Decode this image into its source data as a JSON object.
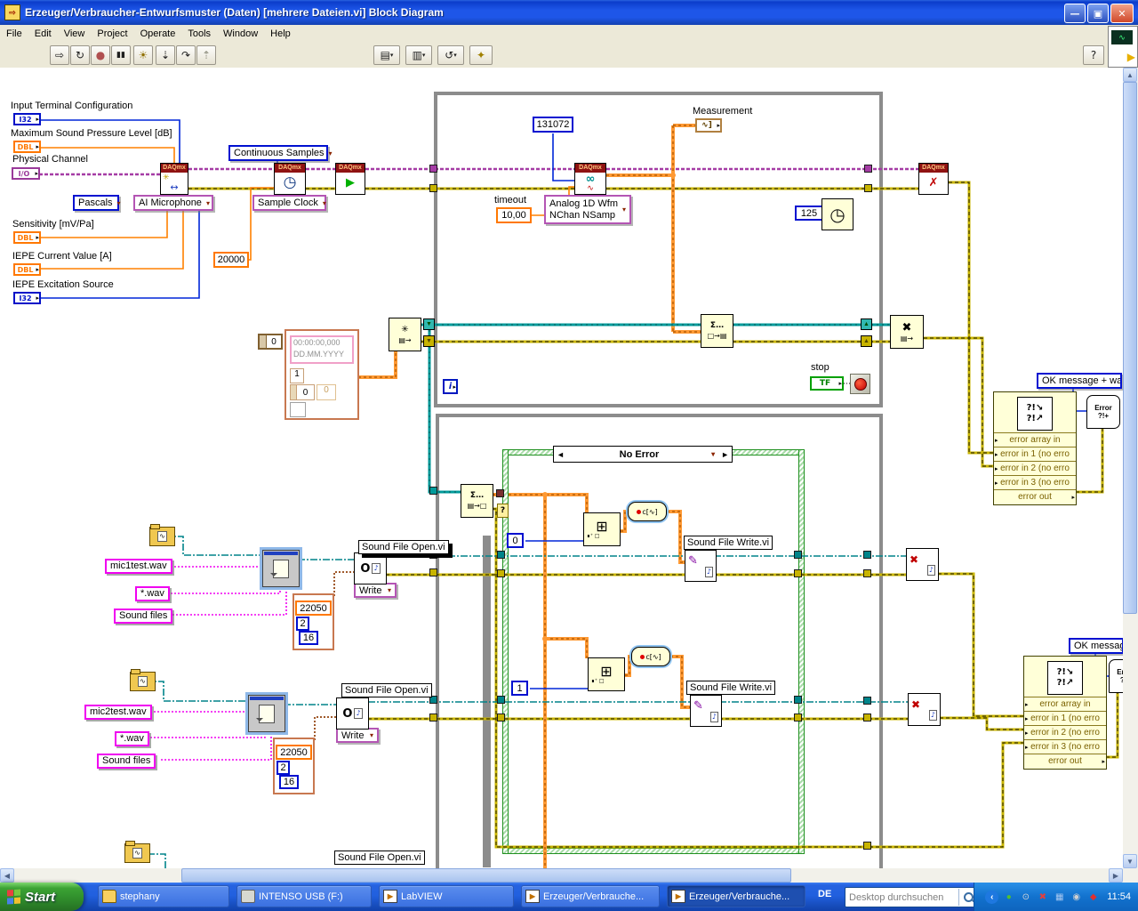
{
  "window": {
    "title": "Erzeuger/Verbraucher-Entwurfsmuster (Daten) [mehrere Dateien.vi] Block Diagram"
  },
  "menu": {
    "items": [
      "File",
      "Edit",
      "View",
      "Project",
      "Operate",
      "Tools",
      "Window",
      "Help"
    ]
  },
  "toolbar": {
    "font": "13pt Application Font",
    "help": "?"
  },
  "controls": {
    "input_terminal": "Input Terminal Configuration",
    "max_pressure": "Maximum Sound Pressure Level  [dB]",
    "physical_channel": "Physical Channel",
    "sensitivity": "Sensitivity [mV/Pa]",
    "iepe_current": "IEPE Current Value [A]",
    "iepe_excitation": "IEPE Excitation Source",
    "t_i32": "I32",
    "t_dbl": "DBL",
    "t_io": "I/O"
  },
  "rings": {
    "pascals": "Pascals",
    "ai_microphone": "AI Microphone",
    "continuous_samples": "Continuous Samples",
    "sample_clock": "Sample Clock",
    "analog1": "Analog 1D Wfm",
    "analog2": "NChan NSamp",
    "write": "Write",
    "ok_warn": "OK message + warn",
    "ok": "OK message"
  },
  "constants": {
    "rate": "20000",
    "buffer": "131072",
    "timeout": "10,00",
    "wait": "125",
    "idx0": "0",
    "idx1": "1",
    "sr": "22050",
    "ch": "2",
    "bits": "16",
    "arr_idx": "0"
  },
  "labels": {
    "timeout": "timeout",
    "measurement": "Measurement",
    "stop": "stop",
    "iter": "i",
    "tf": "TF",
    "daqmx": "DAQmx",
    "open_vi": "Sound File Open.vi",
    "write_vi": "Sound File Write.vi"
  },
  "timestamp": {
    "time": "00:00:00,000",
    "date": "DD.MM.YYYY",
    "dt": "1",
    "y": "0",
    "y2": "0"
  },
  "case": {
    "selector": "No Error"
  },
  "errors": {
    "rows": [
      "error array in",
      "error in 1 (no erro",
      "error in 2 (no erro",
      "error in 3 (no erro",
      "error out"
    ],
    "handler_top": "Error",
    "handler_bottom": "?!+"
  },
  "strings": {
    "file1": "mic1test.wav",
    "file2": "mic2test.wav",
    "pattern": "*.wav",
    "prompt": "Sound files"
  },
  "taskbar": {
    "start": "Start",
    "tasks": [
      "stephany",
      "INTENSO USB (F:)",
      "LabVIEW",
      "Erzeuger/Verbrauche...",
      "Erzeuger/Verbrauche..."
    ],
    "lang": "DE",
    "search": "Desktop durchsuchen",
    "clock": "11:54"
  },
  "icons": {
    "run": "⇨",
    "run_continuous": "↻",
    "abort": "●",
    "pause": "▮▮",
    "highlight": "☀",
    "step_into": "⇣",
    "step_over": "↷",
    "step_out": "⇡",
    "align": "▤",
    "distribute": "▥",
    "reorder": "↺",
    "cleanup": "✦",
    "dropdown": "▾",
    "star": "✳",
    "arrows_lr": "↔",
    "clock": "◷",
    "play": "▶",
    "read": "∞",
    "wave": "∿",
    "cross_red": "✗",
    "x": "✖",
    "sum": "Σ…",
    "q_in": "□→▤",
    "q_out": "▤→□",
    "q": "▤→",
    "grid": "⊞",
    "grid_sub": "∎⁺ □",
    "pencil": "✎",
    "note": "♪",
    "letter_o": "O",
    "convert": "c[∿]",
    "prev": "◄",
    "next": "►",
    "merge1": "?!↘",
    "merge2": "?!↗",
    "min": "—",
    "restore": "▣",
    "close": "✕",
    "back": "‹",
    "q_mark": "?"
  },
  "colors": {
    "task_wire": "#A53CA5",
    "error_wire": "#C8B400",
    "waveform_wire": "#FF9933",
    "queue_wire": "#009A9A",
    "string_wire": "#F000F0",
    "taskbar": "#245EDC"
  }
}
